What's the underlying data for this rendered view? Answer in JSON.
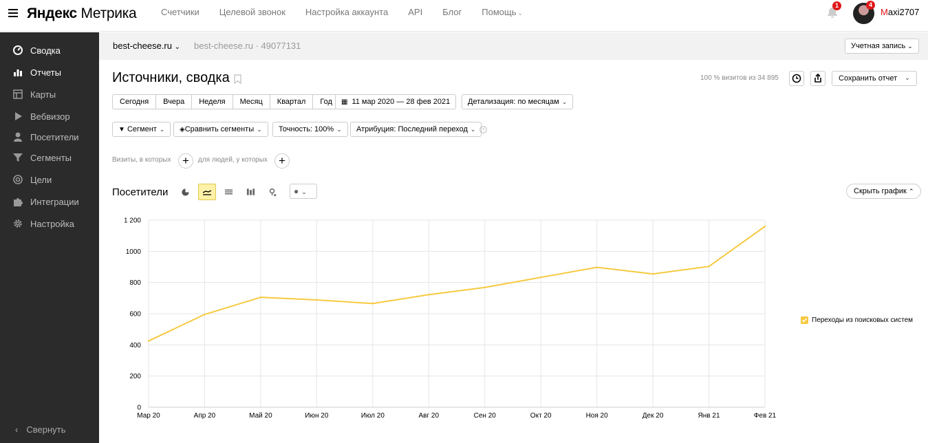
{
  "header": {
    "logo_brand": "Яндекс",
    "logo_product": "Метрика",
    "nav": [
      "Счетчики",
      "Целевой звонок",
      "Настройка аккаунта",
      "API",
      "Блог",
      "Помощь"
    ],
    "notifications_count": "1",
    "avatar_badge": "4",
    "username_first": "M",
    "username_rest": "axi2707"
  },
  "sidebar": {
    "items": [
      {
        "label": "Сводка",
        "icon": "gauge-icon"
      },
      {
        "label": "Отчеты",
        "icon": "bar-chart-icon"
      },
      {
        "label": "Карты",
        "icon": "map-icon"
      },
      {
        "label": "Вебвизор",
        "icon": "play-icon"
      },
      {
        "label": "Посетители",
        "icon": "person-icon"
      },
      {
        "label": "Сегменты",
        "icon": "funnel-icon"
      },
      {
        "label": "Цели",
        "icon": "target-icon"
      },
      {
        "label": "Интеграции",
        "icon": "puzzle-icon"
      },
      {
        "label": "Настройка",
        "icon": "gear-icon"
      }
    ],
    "collapse_label": "Свернуть"
  },
  "counter": {
    "site": "best-cheese.ru",
    "site_id": "best-cheese.ru · 49077131",
    "account_label": "Учетная запись"
  },
  "report": {
    "title": "Источники, сводка",
    "visits_info": "100 % визитов из 34 895",
    "save_label": "Сохранить отчет",
    "periods": [
      "Сегодня",
      "Вчера",
      "Неделя",
      "Месяц",
      "Квартал",
      "Год"
    ],
    "date_range": "11 мар 2020 — 28 фев 2021",
    "detail": "Детализация: по месяцам",
    "segment": "Сегмент",
    "compare": "Сравнить сегменты",
    "accuracy": "Точность: 100%",
    "attribution": "Атрибуция: Последний переход",
    "visits_where": "Визиты, в которых",
    "people_where": "для людей, у которых",
    "chart_title": "Посетители",
    "hide_chart": "Скрыть график"
  },
  "chart_data": {
    "type": "line",
    "categories": [
      "Мар 20",
      "Апр 20",
      "Май 20",
      "Июн 20",
      "Июл 20",
      "Авг 20",
      "Сен 20",
      "Окт 20",
      "Ноя 20",
      "Дек 20",
      "Янв 21",
      "Фев 21"
    ],
    "series": [
      {
        "name": "Переходы из поисковых систем",
        "color": "#f7c940",
        "values": [
          425,
          595,
          705,
          688,
          665,
          722,
          768,
          833,
          897,
          855,
          903,
          1160
        ]
      }
    ],
    "yticks": [
      0,
      200,
      400,
      600,
      800,
      1000,
      1200
    ],
    "ytick_labels": [
      "0",
      "200",
      "400",
      "600",
      "800",
      "1000",
      "1 200"
    ],
    "ylim": [
      0,
      1200
    ],
    "grid": true,
    "legend": "right"
  }
}
